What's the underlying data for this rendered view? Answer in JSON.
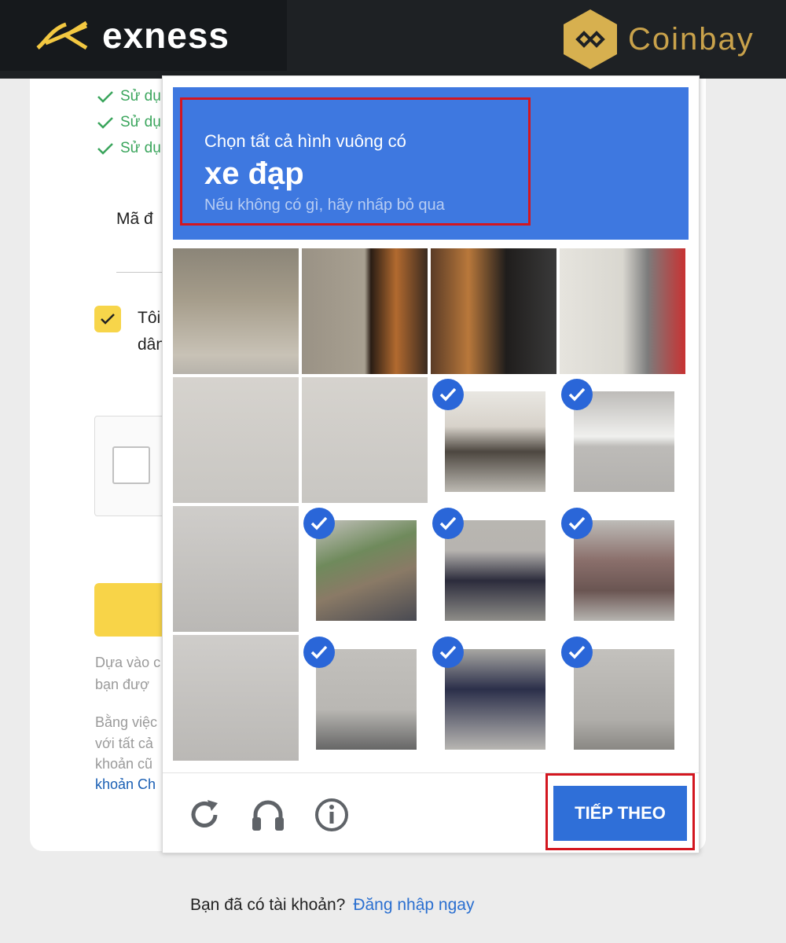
{
  "header": {
    "brand_left": "exness",
    "brand_right": "Coinbay"
  },
  "background_form": {
    "checklist": [
      "Sử dụ",
      "Sử dụ",
      "Sử dụ"
    ],
    "code_label": "Mã đ",
    "agree_line1": "Tôi",
    "agree_line2": "dân",
    "note1_line1": "Dựa vào c",
    "note1_line2": "bạn đượ",
    "note2_line1": "Bằng việc",
    "note2_line2": "với tất cả",
    "note2_line3": "khoản cũ",
    "note2_link": "khoản Ch"
  },
  "footer": {
    "prompt": "Bạn đã có tài khoản?",
    "login_link": "Đăng nhập ngay"
  },
  "captcha": {
    "instruction": "Chọn tất cả hình vuông có",
    "target": "xe đạp",
    "hint": "Nếu không có gì, hãy nhấp bỏ qua",
    "tiles": [
      {
        "selected": false,
        "scene": "stone-wall"
      },
      {
        "selected": false,
        "scene": "restaurant-menu"
      },
      {
        "selected": false,
        "scene": "shop-entrance"
      },
      {
        "selected": false,
        "scene": "white-building"
      },
      {
        "selected": false,
        "scene": "sidewalk"
      },
      {
        "selected": false,
        "scene": "sidewalk"
      },
      {
        "selected": true,
        "scene": "cyclist-head"
      },
      {
        "selected": true,
        "scene": "road-markings"
      },
      {
        "selected": false,
        "scene": "road"
      },
      {
        "selected": true,
        "scene": "bicycle-front"
      },
      {
        "selected": true,
        "scene": "cyclist-body"
      },
      {
        "selected": true,
        "scene": "bicycle-basket"
      },
      {
        "selected": false,
        "scene": "road"
      },
      {
        "selected": true,
        "scene": "bicycle-wheel"
      },
      {
        "selected": true,
        "scene": "bicycle-frame"
      },
      {
        "selected": true,
        "scene": "bicycle-rear"
      }
    ],
    "icons": [
      "reload-icon",
      "headphones-icon",
      "info-icon"
    ],
    "next_label": "TIẾP THEO"
  },
  "colors": {
    "captcha_blue": "#3e78e0",
    "button_blue": "#2f6fd8",
    "highlight_red": "#d3161f",
    "exness_yellow": "#f7d54a",
    "coinbay_gold": "#c9a24b"
  }
}
